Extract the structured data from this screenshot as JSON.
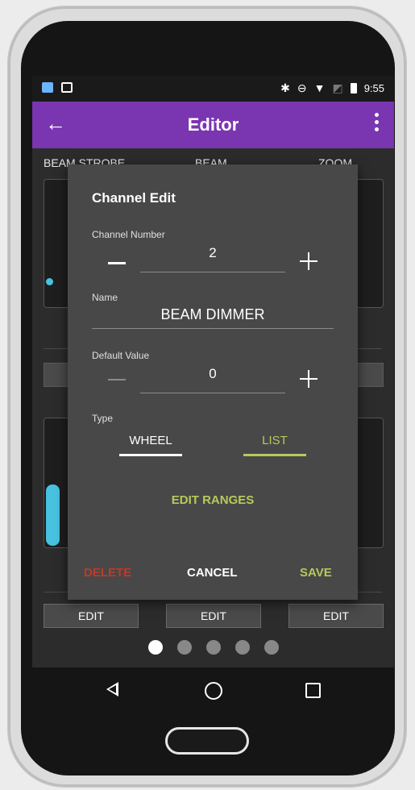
{
  "status_bar": {
    "time": "9:55",
    "icons": [
      "app-notification-icon",
      "image-icon",
      "bluetooth-icon",
      "do-not-disturb-icon",
      "wifi-icon",
      "no-sim-icon",
      "battery-icon"
    ]
  },
  "app_bar": {
    "title": "Editor",
    "back_icon": "arrow-left-icon",
    "menu_icon": "more-vert-icon"
  },
  "background": {
    "column_labels": [
      "BEAM STROBE",
      "BEAM",
      "ZOOM"
    ],
    "edit_buttons": [
      "EDIT",
      "EDIT",
      "EDIT"
    ],
    "pager": {
      "pages": 5,
      "active": 1
    },
    "accent_color": "#47c3e0"
  },
  "dialog": {
    "title": "Channel Edit",
    "channel_number": {
      "label": "Channel Number",
      "value": "2"
    },
    "name": {
      "label": "Name",
      "value": "BEAM DIMMER"
    },
    "default_value": {
      "label": "Default Value",
      "value": "0"
    },
    "type": {
      "label": "Type",
      "options": [
        "WHEEL",
        "LIST"
      ],
      "selected": "LIST"
    },
    "edit_ranges_label": "EDIT RANGES",
    "actions": {
      "delete": "DELETE",
      "cancel": "CANCEL",
      "save": "SAVE"
    },
    "colors": {
      "delete": "#c0392b",
      "accent": "#b9c95a",
      "dialog_bg": "#484848"
    }
  },
  "nav_bar": {
    "icons": [
      "back-icon",
      "home-icon",
      "recents-icon"
    ]
  },
  "colors": {
    "app_bar": "#7a35b0"
  }
}
